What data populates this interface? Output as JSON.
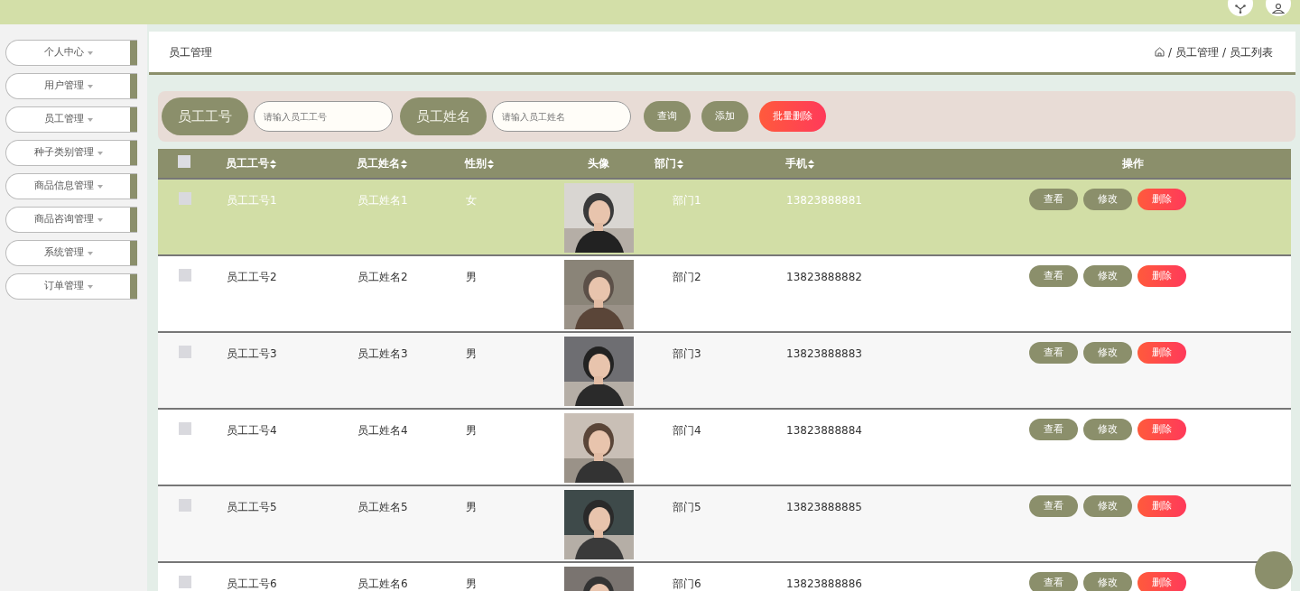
{
  "sidebar": {
    "items": [
      {
        "label": "个人中心"
      },
      {
        "label": "用户管理"
      },
      {
        "label": "员工管理"
      },
      {
        "label": "种子类别管理"
      },
      {
        "label": "商品信息管理"
      },
      {
        "label": "商品咨询管理"
      },
      {
        "label": "系统管理"
      },
      {
        "label": "订单管理"
      }
    ]
  },
  "page_title": "员工管理",
  "breadcrumb": [
    {
      "separator": "/",
      "label": "员工管理"
    },
    {
      "separator": "/",
      "label": "员工列表"
    }
  ],
  "search": {
    "fields": [
      {
        "label": "员工工号",
        "placeholder": "请输入员工工号"
      },
      {
        "label": "员工姓名",
        "placeholder": "请输入员工姓名"
      }
    ],
    "buttons": [
      {
        "label": "查询",
        "kind": "normal"
      },
      {
        "label": "添加",
        "kind": "normal"
      },
      {
        "label": "批量删除",
        "kind": "danger"
      }
    ]
  },
  "table": {
    "all_checked": false,
    "columns": [
      {
        "label": "员工工号",
        "sortable": true
      },
      {
        "label": "员工姓名",
        "sortable": true
      },
      {
        "label": "性别",
        "sortable": true
      },
      {
        "label": "头像",
        "sortable": false
      },
      {
        "label": "部门",
        "sortable": true
      },
      {
        "label": "手机",
        "sortable": true
      },
      {
        "label": "操作",
        "sortable": false
      }
    ],
    "rows": [
      {
        "selected": true,
        "checked": false,
        "cells": [
          "员工工号1",
          "员工姓名1",
          "女",
          "",
          "部门1",
          "13823888881"
        ],
        "actions": [
          "查看",
          "修改",
          "删除"
        ]
      },
      {
        "selected": false,
        "checked": false,
        "cells": [
          "员工工号2",
          "员工姓名2",
          "男",
          "",
          "部门2",
          "13823888882"
        ],
        "actions": [
          "查看",
          "修改",
          "删除"
        ]
      },
      {
        "selected": false,
        "checked": false,
        "cells": [
          "员工工号3",
          "员工姓名3",
          "男",
          "",
          "部门3",
          "13823888883"
        ],
        "actions": [
          "查看",
          "修改",
          "删除"
        ]
      },
      {
        "selected": false,
        "checked": false,
        "cells": [
          "员工工号4",
          "员工姓名4",
          "男",
          "",
          "部门4",
          "13823888884"
        ],
        "actions": [
          "查看",
          "修改",
          "删除"
        ]
      },
      {
        "selected": false,
        "checked": false,
        "cells": [
          "员工工号5",
          "员工姓名5",
          "男",
          "",
          "部门5",
          "13823888885"
        ],
        "actions": [
          "查看",
          "修改",
          "删除"
        ]
      },
      {
        "selected": false,
        "checked": false,
        "cells": [
          "员工工号6",
          "员工姓名6",
          "男",
          "",
          "部门6",
          "13823888886"
        ],
        "actions": [
          "查看",
          "修改",
          "删除"
        ]
      }
    ]
  }
}
